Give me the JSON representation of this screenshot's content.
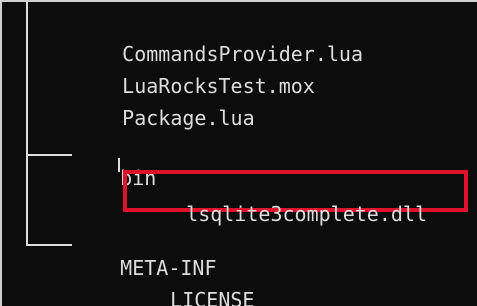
{
  "terminal": {
    "files": [
      {
        "name": "CommandsProvider.lua"
      },
      {
        "name": "LuaRocksTest.mox"
      },
      {
        "name": "Package.lua"
      }
    ],
    "folders": [
      {
        "name": "bin"
      },
      {
        "name": "META-INF"
      }
    ],
    "bin_children": [
      {
        "name": "lsqlite3complete.dll",
        "highlighted": true
      }
    ],
    "meta_inf_children": [
      {
        "name": "LICENSE"
      }
    ],
    "highlight_color": "#e0112b",
    "text_color": "#dcdcdc",
    "background_color": "#0c0c0c"
  }
}
